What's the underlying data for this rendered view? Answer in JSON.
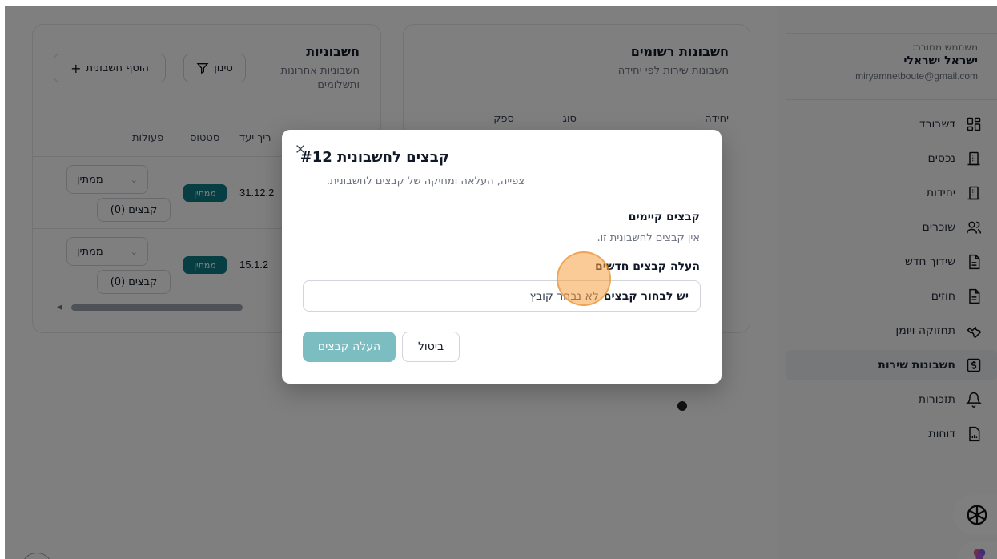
{
  "sidebar": {
    "user_caption": "משתמש מחובר:",
    "user_name": "ישראל ישראלי",
    "user_email": "miryamnetboute@gmail.com",
    "items": [
      {
        "label": "דשבורד",
        "icon": "dashboard-icon"
      },
      {
        "label": "נכסים",
        "icon": "building-icon"
      },
      {
        "label": "יחידות",
        "icon": "building-icon"
      },
      {
        "label": "שוכרים",
        "icon": "users-icon"
      },
      {
        "label": "שידוך חדש",
        "icon": "document-icon"
      },
      {
        "label": "חוזים",
        "icon": "document-icon"
      },
      {
        "label": "תחזוקה ויומן",
        "icon": "wrench-icon"
      },
      {
        "label": "חשבונות שירות",
        "icon": "dollar-icon",
        "active": true
      },
      {
        "label": "תזכורות",
        "icon": "bell-icon"
      },
      {
        "label": "דוחות",
        "icon": "report-icon"
      }
    ]
  },
  "registered": {
    "title": "חשבונות רשומים",
    "subtitle": "חשבונות שירות לפי יחידה",
    "columns": [
      "יחידה",
      "סוג",
      "ספק"
    ]
  },
  "invoices": {
    "title": "חשבוניות",
    "subtitle": "חשבוניות אחרונות ותשלומים",
    "filter_label": "סינון",
    "add_label": "הוסף חשבונית",
    "columns": [
      "ריך יעד",
      "סטטוס",
      "פעולות"
    ],
    "rows": [
      {
        "date": "31.12.2",
        "status": "ממתין",
        "action": "ממתין",
        "files": "קבצים (0)"
      },
      {
        "date": "15.1.2",
        "status": "ממתין",
        "action": "ממתין",
        "files": "קבצים (0)"
      }
    ]
  },
  "modal": {
    "title": "קבצים לחשבונית #12",
    "description": "צפייה, העלאה ומחיקה של קבצים לחשבונית.",
    "existing_title": "קבצים קיימים",
    "existing_empty": "אין קבצים לחשבונית זו.",
    "upload_title": "העלה קבצים חדשים",
    "choose_label": "יש לבחור קבצים",
    "no_file_label": "לא נבחר קובץ",
    "cancel_label": "ביטול",
    "upload_label": "העלה קבצים"
  },
  "colors": {
    "accent": "#0e7c86",
    "upload_button": "#7bbdc1",
    "cursor_highlight": "#f59e42"
  }
}
